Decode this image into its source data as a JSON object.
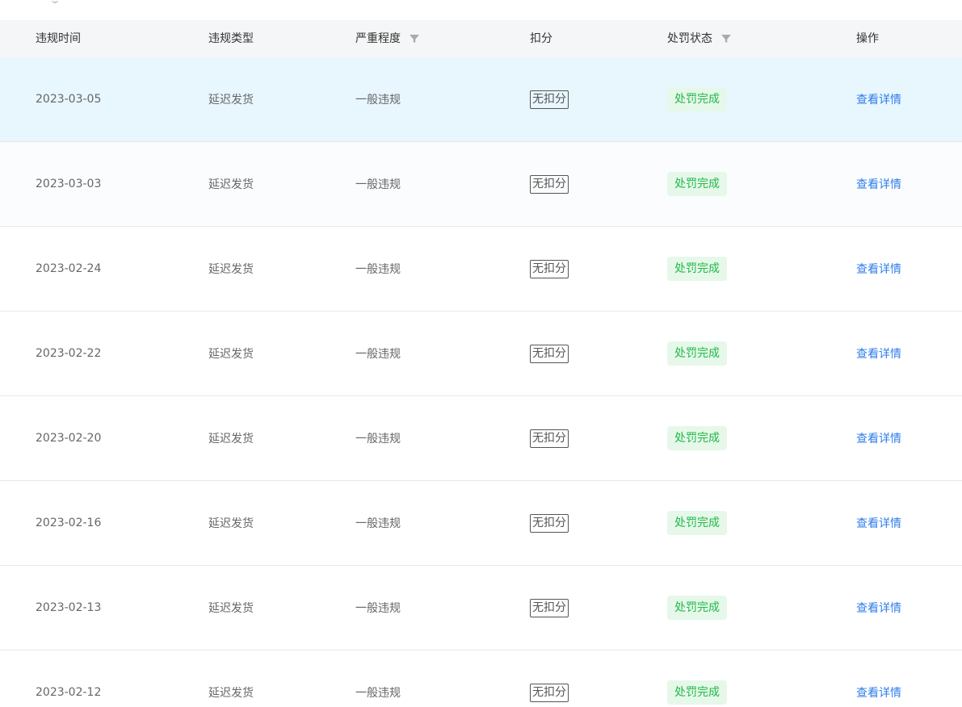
{
  "table": {
    "columns": [
      {
        "key": "time",
        "label": "违规时间"
      },
      {
        "key": "type",
        "label": "违规类型"
      },
      {
        "key": "severity",
        "label": "严重程度",
        "filterable": true
      },
      {
        "key": "score",
        "label": "扣分"
      },
      {
        "key": "status",
        "label": "处罚状态",
        "filterable": true
      },
      {
        "key": "action",
        "label": "操作"
      }
    ],
    "rows": [
      {
        "time": "2023-03-05",
        "type": "延迟发货",
        "severity": "一般违规",
        "score": "无扣分",
        "status": "处罚完成",
        "action": "查看详情"
      },
      {
        "time": "2023-03-03",
        "type": "延迟发货",
        "severity": "一般违规",
        "score": "无扣分",
        "status": "处罚完成",
        "action": "查看详情"
      },
      {
        "time": "2023-02-24",
        "type": "延迟发货",
        "severity": "一般违规",
        "score": "无扣分",
        "status": "处罚完成",
        "action": "查看详情"
      },
      {
        "time": "2023-02-22",
        "type": "延迟发货",
        "severity": "一般违规",
        "score": "无扣分",
        "status": "处罚完成",
        "action": "查看详情"
      },
      {
        "time": "2023-02-20",
        "type": "延迟发货",
        "severity": "一般违规",
        "score": "无扣分",
        "status": "处罚完成",
        "action": "查看详情"
      },
      {
        "time": "2023-02-16",
        "type": "延迟发货",
        "severity": "一般违规",
        "score": "无扣分",
        "status": "处罚完成",
        "action": "查看详情"
      },
      {
        "time": "2023-02-13",
        "type": "延迟发货",
        "severity": "一般违规",
        "score": "无扣分",
        "status": "处罚完成",
        "action": "查看详情"
      },
      {
        "time": "2023-02-12",
        "type": "延迟发货",
        "severity": "一般违规",
        "score": "无扣分",
        "status": "处罚完成",
        "action": "查看详情"
      }
    ]
  },
  "icons": {
    "filter": "filter-icon"
  },
  "colors": {
    "header_bg": "#f5f6f7",
    "selected_row_bg": "#e8f6fe",
    "status_tag_bg": "#e6f8e9",
    "status_tag_text": "#22b84a",
    "link": "#2f7ee9",
    "text": "#666666",
    "header_text": "#333333",
    "border": "#e8e8e8"
  }
}
